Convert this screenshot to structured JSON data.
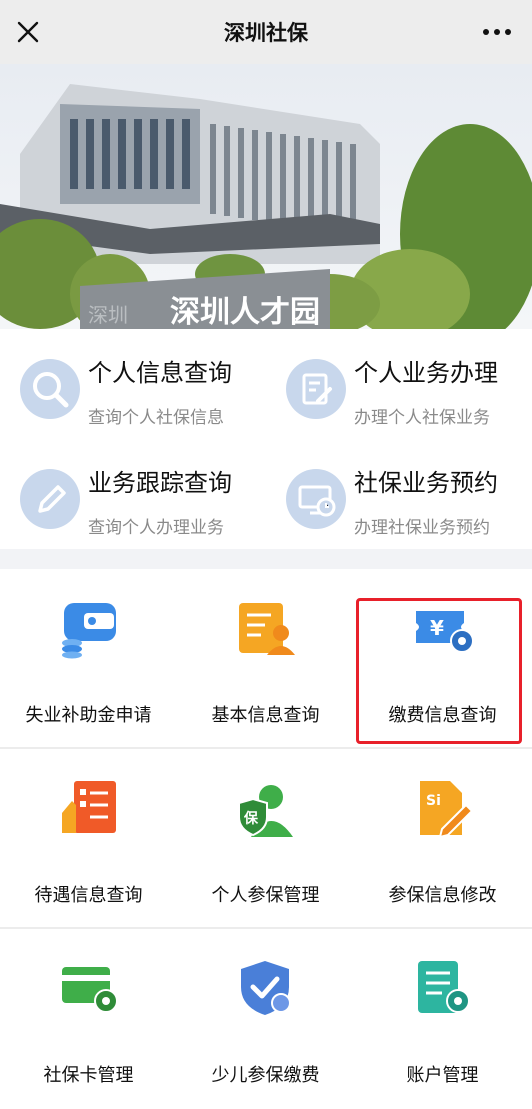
{
  "header": {
    "title": "深圳社保",
    "close_icon": "close-icon",
    "more_icon": "more-dots-icon"
  },
  "banner": {
    "sign_text": "深圳人才园",
    "sign_small": "深圳"
  },
  "quick_services": [
    {
      "title": "个人信息查询",
      "subtitle": "查询个人社保信息",
      "icon": "search-icon"
    },
    {
      "title": "个人业务办理",
      "subtitle": "办理个人社保业务",
      "icon": "edit-document-icon"
    },
    {
      "title": "业务跟踪查询",
      "subtitle": "查询个人办理业务",
      "icon": "pencil-icon"
    },
    {
      "title": "社保业务预约",
      "subtitle": "办理社保业务预约",
      "icon": "monitor-clock-icon"
    }
  ],
  "services": [
    {
      "label": "失业补助金申请",
      "icon": "wallet-icon",
      "color": "#3b8be6"
    },
    {
      "label": "基本信息查询",
      "icon": "person-card-icon",
      "color": "#f5a623"
    },
    {
      "label": "缴费信息查询",
      "icon": "yuan-ticket-gear-icon",
      "color": "#3b8be6"
    },
    {
      "label": "待遇信息查询",
      "icon": "hand-checklist-icon",
      "color": "#f05a28"
    },
    {
      "label": "个人参保管理",
      "icon": "insured-person-icon",
      "color": "#3fae49"
    },
    {
      "label": "参保信息修改",
      "icon": "si-document-edit-icon",
      "color": "#f5a623"
    },
    {
      "label": "社保卡管理",
      "icon": "card-gear-icon",
      "color": "#3fae49"
    },
    {
      "label": "少儿参保缴费",
      "icon": "shield-check-icon",
      "color": "#4a7fd8"
    },
    {
      "label": "账户管理",
      "icon": "document-gear-icon",
      "color": "#2db5a0"
    }
  ],
  "colors": {
    "highlight": "#e8202a",
    "quick_icon_bg": "#c8d7ec",
    "header_bg": "#ededed"
  }
}
